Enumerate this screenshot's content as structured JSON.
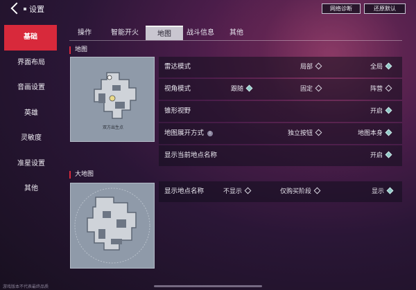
{
  "header": {
    "title": "设置",
    "buttons": {
      "diagnose": "网络诊断",
      "reset": "还原默认"
    }
  },
  "sidebar": {
    "items": [
      {
        "label": "基础",
        "active": true
      },
      {
        "label": "界面布局"
      },
      {
        "label": "音画设置"
      },
      {
        "label": "英雄"
      },
      {
        "label": "灵敏度"
      },
      {
        "label": "准星设置"
      },
      {
        "label": "其他"
      }
    ]
  },
  "tabs": [
    {
      "label": "操作"
    },
    {
      "label": "智能开火"
    },
    {
      "label": "地图",
      "active": true
    },
    {
      "label": "战斗信息"
    },
    {
      "label": "其他"
    }
  ],
  "minimap": {
    "section_label": "地图",
    "caption": "双方出生点",
    "rows": [
      {
        "label": "雷达模式",
        "options": [
          {
            "text": "局部",
            "selected": false
          },
          {
            "text": "全局",
            "selected": true
          }
        ]
      },
      {
        "label": "视角模式",
        "options": [
          {
            "text": "跟随",
            "selected": true
          },
          {
            "text": "固定",
            "selected": false
          },
          {
            "text": "阵营",
            "selected": false
          }
        ]
      },
      {
        "label": "锥形视野",
        "options": [
          {
            "text": "开启",
            "selected": true
          }
        ]
      },
      {
        "label": "地图展开方式",
        "info": "i",
        "options": [
          {
            "text": "独立按钮",
            "selected": false
          },
          {
            "text": "地图本身",
            "selected": true
          }
        ]
      },
      {
        "label": "显示当前地点名称",
        "options": [
          {
            "text": "开启",
            "selected": true
          }
        ]
      }
    ]
  },
  "bigmap": {
    "section_label": "大地图",
    "rows": [
      {
        "label": "显示地点名称",
        "options": [
          {
            "text": "不显示",
            "selected": false
          },
          {
            "text": "仅购买阶段",
            "selected": false
          },
          {
            "text": "显示",
            "selected": true
          }
        ]
      }
    ]
  },
  "footer": {
    "note": "游戏版本不代表最终品质"
  },
  "colors": {
    "accent": "#d8293b",
    "selected": "#8fc9c8",
    "tab_active": "#c9c6d0"
  }
}
